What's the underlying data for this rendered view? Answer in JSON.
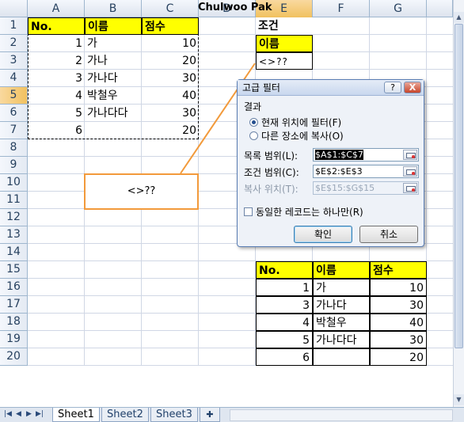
{
  "window": {
    "title": "Chulwoo Pak"
  },
  "columns": [
    "A",
    "B",
    "C",
    "D",
    "E",
    "F",
    "G"
  ],
  "rows": [
    "1",
    "2",
    "3",
    "4",
    "5",
    "6",
    "7",
    "8",
    "9",
    "10",
    "11",
    "12",
    "13",
    "14",
    "15",
    "16",
    "17",
    "18",
    "19",
    "20"
  ],
  "selected_row": "5",
  "selected_column": "E",
  "source_table": {
    "headers": [
      "No.",
      "이름",
      "점수"
    ],
    "rows": [
      [
        "1",
        "가",
        "10"
      ],
      [
        "2",
        "가나",
        "20"
      ],
      [
        "3",
        "가나다",
        "30"
      ],
      [
        "4",
        "박철우",
        "40"
      ],
      [
        "5",
        "가나다다",
        "30"
      ],
      [
        "6",
        "",
        "20"
      ]
    ]
  },
  "criteria": {
    "title": "조건",
    "header": "이름",
    "value": "<>??"
  },
  "callout": {
    "text": "<>??"
  },
  "dialog": {
    "title": "고급 필터",
    "help_label": "?",
    "close_label": "X",
    "result_label": "결과",
    "option_filter_in_place": "현재 위치에 필터(F)",
    "option_copy_to": "다른 장소에 복사(O)",
    "list_range_label": "목록 범위(L):",
    "list_range_value": "$A$1:$C$7",
    "criteria_range_label": "조건 범위(C):",
    "criteria_range_value": "$E$2:$E$3",
    "copy_to_label": "복사 위치(T):",
    "copy_to_value": "$E$15:$G$15",
    "unique_label": "동일한 레코드는 하나만(R)",
    "ok_label": "확인",
    "cancel_label": "취소"
  },
  "result_table": {
    "headers": [
      "No.",
      "이름",
      "점수"
    ],
    "rows": [
      [
        "1",
        "가",
        "10"
      ],
      [
        "3",
        "가나다",
        "30"
      ],
      [
        "4",
        "박철우",
        "40"
      ],
      [
        "5",
        "가나다다",
        "30"
      ],
      [
        "6",
        "",
        "20"
      ]
    ]
  },
  "sheets": [
    "Sheet1",
    "Sheet2",
    "Sheet3"
  ],
  "active_sheet": "Sheet1"
}
